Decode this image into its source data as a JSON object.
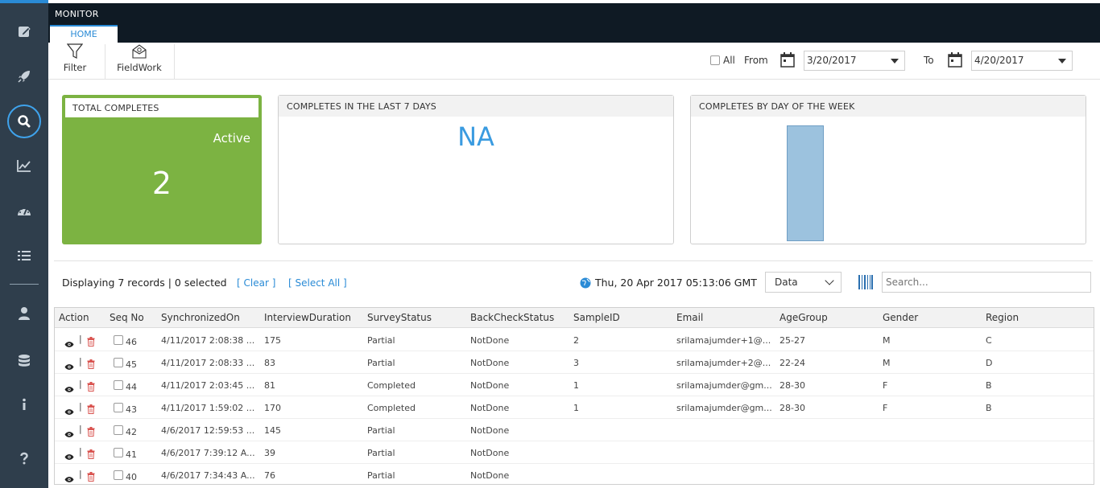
{
  "header": {
    "title": "MONITOR",
    "tab": "HOME"
  },
  "toolbar": {
    "filter_label": "Filter",
    "fieldwork_label": "FieldWork",
    "all_label": "All",
    "from_label": "From",
    "from_date": "3/20/2017",
    "to_label": "To",
    "to_date": "4/20/2017"
  },
  "cards": {
    "total": {
      "title": "TOTAL COMPLETES",
      "status": "Active",
      "value": "2"
    },
    "last7": {
      "title": "COMPLETES IN THE LAST 7 DAYS",
      "value": "NA"
    },
    "byday": {
      "title": "COMPLETES BY DAY OF THE WEEK"
    }
  },
  "records": {
    "summary": "Displaying 7 records | 0 selected",
    "clear_label": "[ Clear ]",
    "select_all_label": "[ Select All ]",
    "datetime": "Thu, 20 Apr 2017 05:13:06 GMT",
    "view_select": "Data",
    "search_placeholder": "Search..."
  },
  "table": {
    "columns": [
      "Action",
      "Seq No",
      "SynchronizedOn",
      "InterviewDuration",
      "SurveyStatus",
      "BackCheckStatus",
      "SampleID",
      "Email",
      "AgeGroup",
      "Gender",
      "Region"
    ],
    "rows": [
      {
        "seq": "46",
        "sync": "4/11/2017 2:08:38 ...",
        "duration": "175",
        "status": "Partial",
        "backcheck": "NotDone",
        "sample": "2",
        "email": "srilamajumder+1@...",
        "age": "25-27",
        "gender": "M",
        "region": "C"
      },
      {
        "seq": "45",
        "sync": "4/11/2017 2:08:33 ...",
        "duration": "83",
        "status": "Partial",
        "backcheck": "NotDone",
        "sample": "3",
        "email": "srilamajumder+2@...",
        "age": "22-24",
        "gender": "M",
        "region": "D"
      },
      {
        "seq": "44",
        "sync": "4/11/2017 2:03:45 ...",
        "duration": "81",
        "status": "Completed",
        "backcheck": "NotDone",
        "sample": "1",
        "email": "srilamajumder@gm...",
        "age": "28-30",
        "gender": "F",
        "region": "B"
      },
      {
        "seq": "43",
        "sync": "4/11/2017 1:59:02 ...",
        "duration": "170",
        "status": "Completed",
        "backcheck": "NotDone",
        "sample": "1",
        "email": "srilamajumder@gm...",
        "age": "28-30",
        "gender": "F",
        "region": "B"
      },
      {
        "seq": "42",
        "sync": "4/6/2017 12:59:53 ...",
        "duration": "145",
        "status": "Partial",
        "backcheck": "NotDone",
        "sample": "",
        "email": "",
        "age": "",
        "gender": "",
        "region": ""
      },
      {
        "seq": "41",
        "sync": "4/6/2017 7:39:12 A...",
        "duration": "39",
        "status": "Partial",
        "backcheck": "NotDone",
        "sample": "",
        "email": "",
        "age": "",
        "gender": "",
        "region": ""
      },
      {
        "seq": "40",
        "sync": "4/6/2017 7:34:43 A...",
        "duration": "76",
        "status": "Partial",
        "backcheck": "NotDone",
        "sample": "",
        "email": "",
        "age": "",
        "gender": "",
        "region": ""
      }
    ]
  },
  "sidebar": {
    "items": [
      {
        "icon": "edit-icon"
      },
      {
        "icon": "rocket-icon"
      },
      {
        "icon": "search-icon",
        "active": true
      },
      {
        "icon": "chart-line-icon"
      },
      {
        "icon": "dashboard-icon"
      },
      {
        "icon": "list-icon"
      },
      {
        "icon": "user-icon"
      },
      {
        "icon": "database-icon"
      },
      {
        "icon": "info-icon"
      },
      {
        "icon": "help-icon"
      }
    ]
  },
  "colors": {
    "sidebar": "#2f3e4c",
    "topbar": "#0f1a24",
    "accent": "#2a8bd6",
    "active_card": "#7cb342",
    "bar": "#9cc2de"
  }
}
